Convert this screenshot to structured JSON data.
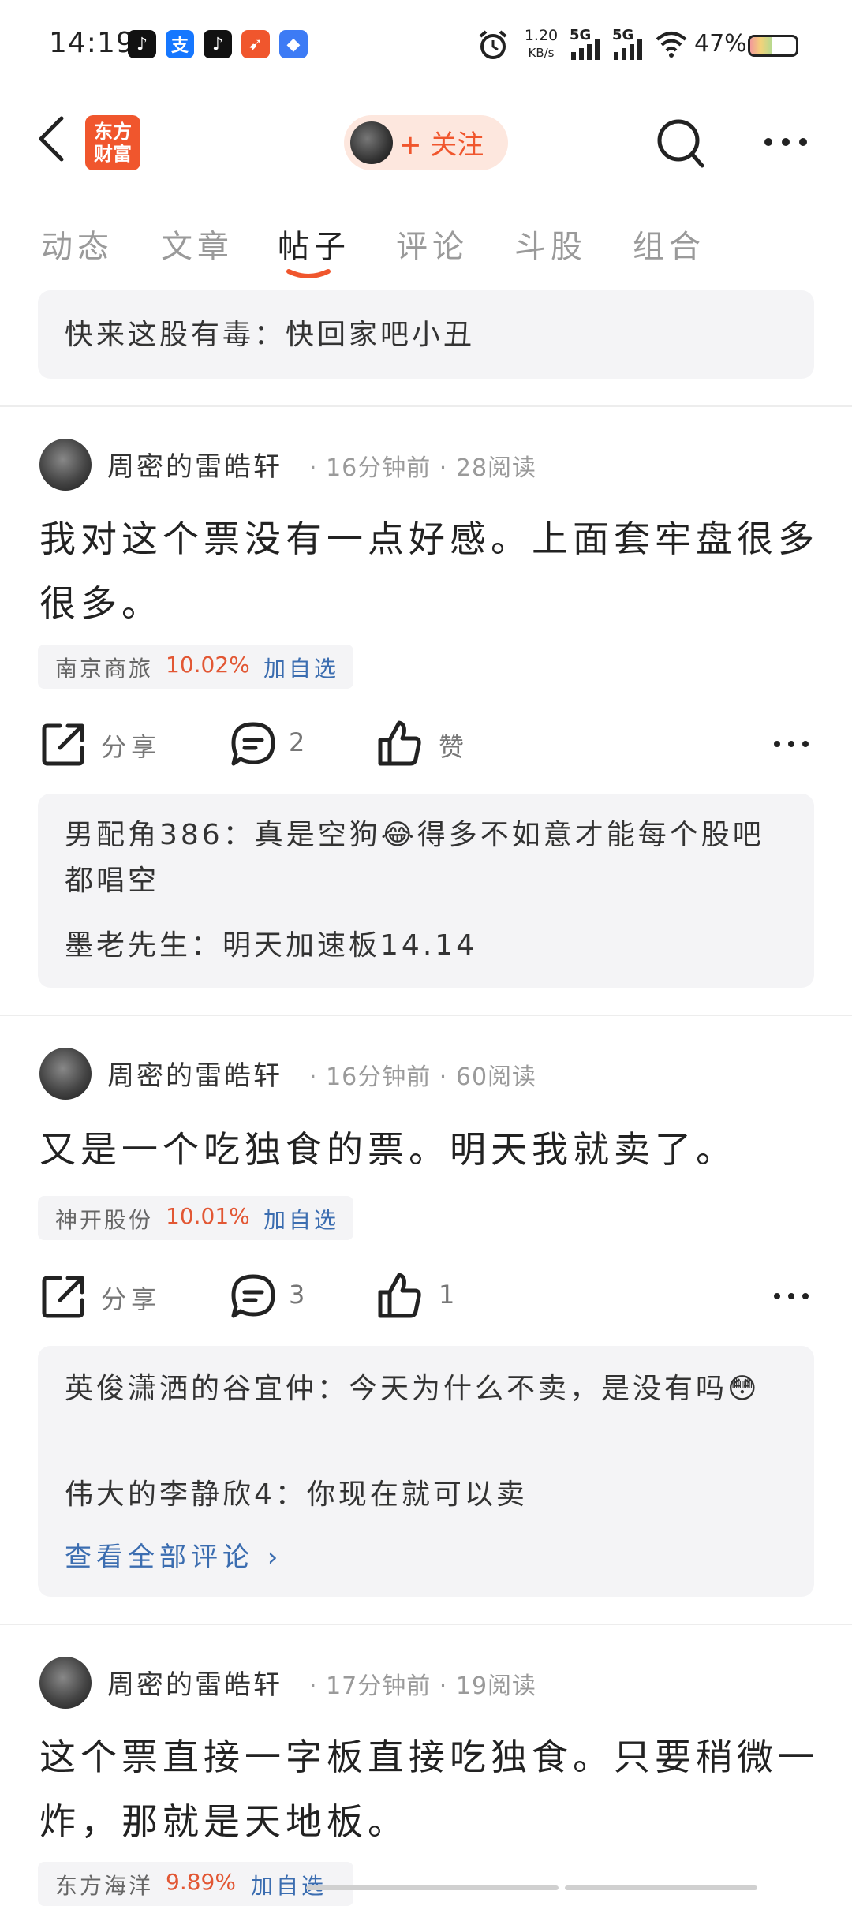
{
  "status_bar": {
    "time": "14:19",
    "network_speed_value": "1.20",
    "network_speed_unit": "KB/s",
    "signal_1": "5G",
    "signal_2": "5G",
    "battery": "47%"
  },
  "header": {
    "logo_line1": "东方",
    "logo_line2": "财富",
    "follow_label": "+ 关注"
  },
  "tabs": [
    {
      "label": "动态"
    },
    {
      "label": "文章"
    },
    {
      "label": "帖子",
      "active": true
    },
    {
      "label": "评论"
    },
    {
      "label": "斗股"
    },
    {
      "label": "组合"
    }
  ],
  "top_comment": {
    "author": "快来这股有毒",
    "text": "：快回家吧小丑"
  },
  "posts": [
    {
      "author": "周密的雷皓轩",
      "meta": "· 16分钟前 · 28阅读",
      "text": "我对这个票没有一点好感。上面套牢盘很多很多。",
      "stock_name": "南京商旅",
      "stock_change": "10.02%",
      "add_label": "加自选",
      "share_label": "分享",
      "comment_count": "2",
      "like_label": "赞",
      "comments": [
        {
          "author": "男配角386",
          "text": "：真是空狗😂得多不如意才能每个股吧都唱空"
        },
        {
          "author": "墨老先生",
          "text": "：明天加速板14.14"
        }
      ]
    },
    {
      "author": "周密的雷皓轩",
      "meta": "· 16分钟前 · 60阅读",
      "text": "又是一个吃独食的票。明天我就卖了。",
      "stock_name": "神开股份",
      "stock_change": "10.01%",
      "add_label": "加自选",
      "share_label": "分享",
      "comment_count": "3",
      "like_label": "1",
      "comments": [
        {
          "author": "英俊潇洒的谷宜仲",
          "text": "：今天为什么不卖，是没有吗😳"
        },
        {
          "author": "伟大的李静欣4",
          "text": "：你现在就可以卖"
        }
      ],
      "view_all_label": "查看全部评论 ›"
    },
    {
      "author": "周密的雷皓轩",
      "meta": "· 17分钟前 · 19阅读",
      "text": "这个票直接一字板直接吃独食。只要稍微一炸，那就是天地板。",
      "stock_name": "东方海洋",
      "stock_change": "9.89%",
      "add_label": "加自选"
    }
  ],
  "colors": {
    "accent": "#f0562d",
    "link": "#3b6db0",
    "up": "#e25734",
    "muted": "#9a9a9a",
    "panel": "#f4f4f6"
  }
}
